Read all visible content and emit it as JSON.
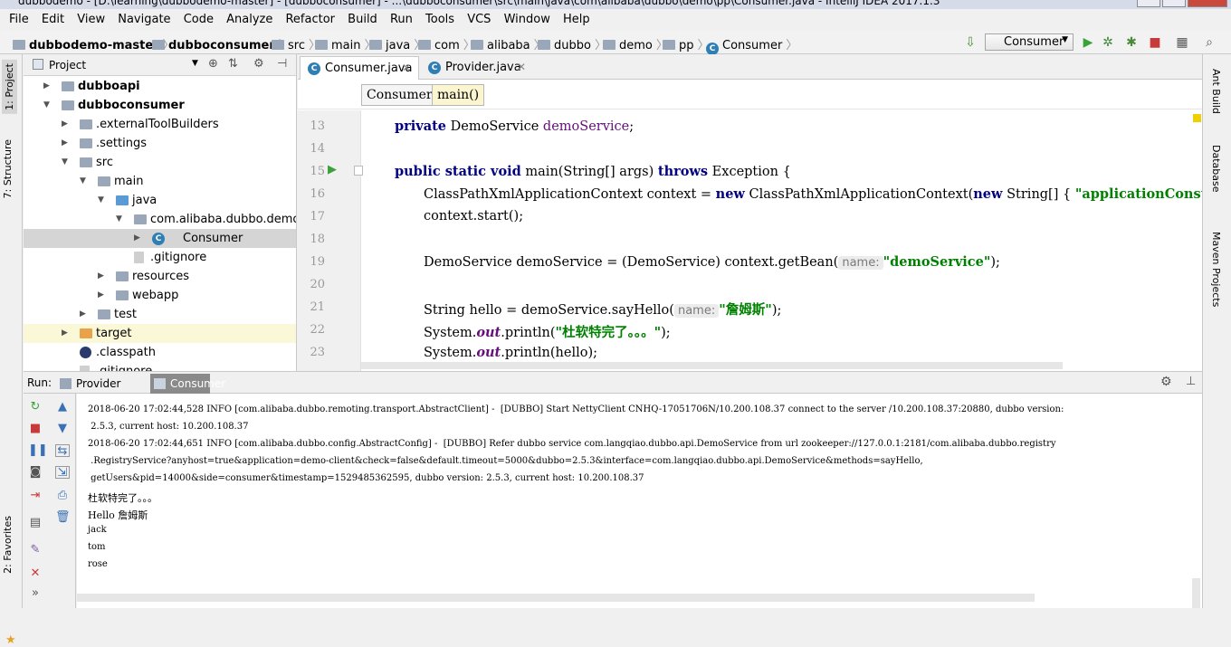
{
  "window": {
    "title": "dubbodemo - [D:\\learning\\dubbodemo-master] - [dubboconsumer] - ...\\dubboconsumer\\src\\main\\java\\com\\alibaba\\dubbo\\demo\\pp\\Consumer.java - IntelliJ IDEA 2017.1.3"
  },
  "menu": [
    "File",
    "Edit",
    "View",
    "Navigate",
    "Code",
    "Analyze",
    "Refactor",
    "Build",
    "Run",
    "Tools",
    "VCS",
    "Window",
    "Help"
  ],
  "nav": {
    "crumbs": [
      "dubbodemo-master",
      "dubboconsumer",
      "src",
      "main",
      "java",
      "com",
      "alibaba",
      "dubbo",
      "demo",
      "pp",
      "Consumer"
    ],
    "run_config": "Consumer"
  },
  "left_strip": {
    "project_tab": "1: Project",
    "structure_tab": "7: Structure",
    "favorites_tab": "2: Favorites"
  },
  "right_strip": {
    "ant_tab": "Ant Build",
    "database_tab": "Database",
    "maven_tab": "Maven Projects"
  },
  "project": {
    "header": "Project",
    "tree": [
      {
        "label": "dubboapi",
        "bold": true
      },
      {
        "label": "dubboconsumer",
        "bold": true
      },
      {
        "label": ".externalToolBuilders"
      },
      {
        "label": ".settings"
      },
      {
        "label": "src"
      },
      {
        "label": "main"
      },
      {
        "label": "java"
      },
      {
        "label": "com.alibaba.dubbo.demo.pp"
      },
      {
        "label": "Consumer"
      },
      {
        "label": ".gitignore"
      },
      {
        "label": "resources"
      },
      {
        "label": "webapp"
      },
      {
        "label": "test"
      },
      {
        "label": "target"
      },
      {
        "label": ".classpath"
      },
      {
        "label": ".gitignore"
      }
    ]
  },
  "editor": {
    "tabs": [
      "Consumer.java",
      "Provider.java"
    ],
    "breadcrumbs": [
      "Consumer",
      "main()"
    ],
    "line_numbers": [
      "13",
      "14",
      "15",
      "16",
      "17",
      "18",
      "19",
      "20",
      "21",
      "22",
      "23"
    ],
    "code": {
      "l13_kw": "private",
      "l13_type": " DemoService ",
      "l13_field": "demoService",
      "l13_end": ";",
      "l15_kw": "public static void",
      "l15_sig": " main(String[] args) ",
      "l15_throws": "throws",
      "l15_end": " Exception {",
      "l16_a": "ClassPathXmlApplicationContext context = ",
      "l16_new": "new",
      "l16_b": " ClassPathXmlApplicationContext(",
      "l16_new2": "new",
      "l16_c": " String[] { ",
      "l16_str": "\"applicationConsumer.xml\"",
      "l17": "context.start();",
      "l19_a": "DemoService demoService = (DemoService) context.getBean(",
      "l19_hint": "name:",
      "l19_str": "\"demoService\"",
      "l19_end": ");",
      "l21_a": "String hello = demoService.sayHello(",
      "l21_hint": "name:",
      "l21_str": "\"詹姆斯\"",
      "l21_end": ");",
      "l22_a": "System.",
      "l22_out": "out",
      "l22_b": ".println(",
      "l22_str": "\"杜软特完了。。。\"",
      "l22_end": ");",
      "l23_a": "System.",
      "l23_out": "out",
      "l23_b": ".println(hello);"
    }
  },
  "run": {
    "label": "Run:",
    "tabs": [
      "Provider",
      "Consumer"
    ],
    "console": [
      "2018-06-20 17:02:44,528 INFO [com.alibaba.dubbo.remoting.transport.AbstractClient] -  [DUBBO] Start NettyClient CNHQ-17051706N/10.200.108.37 connect to the server /10.200.108.37:20880, dubbo version:",
      " 2.5.3, current host: 10.200.108.37",
      "2018-06-20 17:02:44,651 INFO [com.alibaba.dubbo.config.AbstractConfig] -  [DUBBO] Refer dubbo service com.langqiao.dubbo.api.DemoService from url zookeeper://127.0.0.1:2181/com.alibaba.dubbo.registry",
      " .RegistryService?anyhost=true&application=demo-client&check=false&default.timeout=5000&dubbo=2.5.3&interface=com.langqiao.dubbo.api.DemoService&methods=sayHello,",
      " getUsers&pid=14000&side=consumer&timestamp=1529485362595, dubbo version: 2.5.3, current host: 10.200.108.37",
      "杜软特完了。。。",
      "Hello 詹姆斯",
      "jack",
      "tom",
      "rose"
    ]
  }
}
